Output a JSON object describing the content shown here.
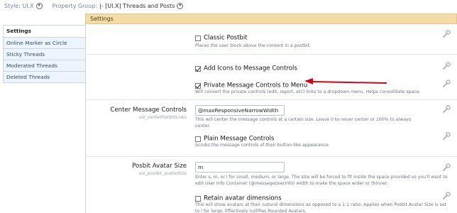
{
  "topbar": {
    "style_label": "Style: UI.X",
    "group_label": "Property Group:",
    "group_value": "|- [UI.X] Threads and Posts"
  },
  "tab": {
    "title": "Settings"
  },
  "sidebar": {
    "items": [
      {
        "label": "Settings",
        "active": true
      },
      {
        "label": "Online Marker as Circle",
        "active": false
      },
      {
        "label": "Sticky Threads",
        "active": false
      },
      {
        "label": "Moderated Threads",
        "active": false
      },
      {
        "label": "Deleted Threads",
        "active": false
      }
    ]
  },
  "options": {
    "classic_postbit": {
      "label": "Classic Postbit",
      "checked": false,
      "hint": "Places the user block above the content in a postbit."
    },
    "add_icons": {
      "label": "Add Icons to Message Controls",
      "checked": true
    },
    "private_controls": {
      "label": "Private Message Controls to Menu",
      "checked": true,
      "hint": "Will convert the private controls (edit, report, etc) links to a dropdown menu. Helps consolidate space."
    },
    "center_controls": {
      "label": "Center Message Controls",
      "sublabel": "uix_centerPostbitLinks",
      "value": "@maxResponsiveNarrowWidth",
      "hint": "This will center the message controls at a certain size. Leave 0 to never center or 100% to always center."
    },
    "plain_controls": {
      "label": "Plain Message Controls",
      "checked": false,
      "hint": "Scrubs the message controls of their button-like appearance."
    },
    "avatar_size": {
      "label": "Posbit Avatar Size",
      "sublabel": "uix_postbit_avatarSize",
      "value": "m",
      "hint": "Enter s, m, or l for small, medium, or large. The size will be forced to fit inside the space provided so you'll want to edit User Info Container (@messageUserInfo) width to make the space wider or thinner."
    },
    "retain_dims": {
      "label": "Retain avatar dimensions",
      "checked": false,
      "hint": "This will show avatars at their natural dimensions as opposed to a 1:1 ratio. Applies when Posbit Avatar Size is set to l for large. Effectively nullifies Rounded Avatars."
    }
  },
  "colors": {
    "tab_bg": "#f3dca7",
    "sidebar_bg": "#eef4fb",
    "link_blue": "#2e4b72",
    "arrow_red": "#d0021b"
  }
}
